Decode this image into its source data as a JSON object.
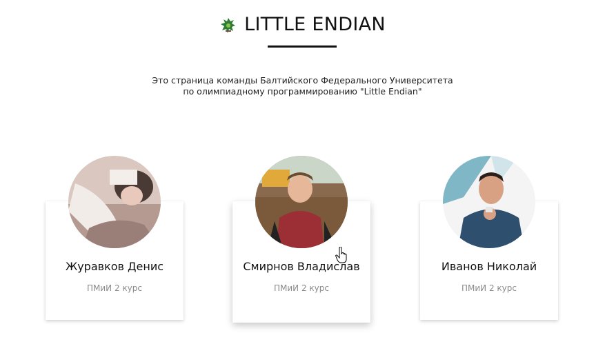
{
  "header": {
    "title": "LITTLE ENDIAN"
  },
  "description": {
    "line1": "Это страница команды Балтийского Федерального Университета",
    "line2": "по олимпиадному программированию \"Little Endian\""
  },
  "members": [
    {
      "name": "Журавков Денис",
      "course": "ПМиИ 2 курс"
    },
    {
      "name": "Смирнов Владислав",
      "course": "ПМиИ 2 курс"
    },
    {
      "name": "Иванов Николай",
      "course": "ПМиИ 2 курс"
    }
  ],
  "colors": {
    "text": "#111111",
    "muted": "#8a8a8a",
    "logo_green": "#2e7d32"
  }
}
